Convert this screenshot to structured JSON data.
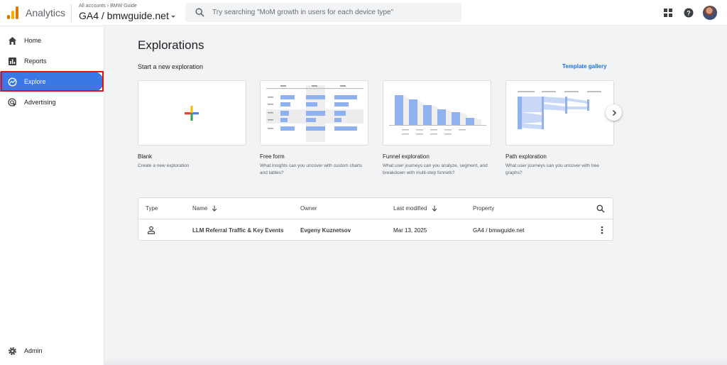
{
  "app": {
    "name": "Analytics",
    "breadcrumb": {
      "all_accounts": "All accounts",
      "account": "BMW Guide"
    },
    "property": "GA4 / bmwguide.net"
  },
  "search": {
    "placeholder": "Try searching \"MoM growth in users for each device type\""
  },
  "header_icons": [
    "apps-grid-icon",
    "help-icon",
    "avatar"
  ],
  "sidebar": {
    "items": [
      {
        "label": "Home",
        "icon": "home-icon"
      },
      {
        "label": "Reports",
        "icon": "reports-icon"
      },
      {
        "label": "Explore",
        "icon": "explore-icon",
        "active": true
      },
      {
        "label": "Advertising",
        "icon": "advertising-icon"
      }
    ],
    "admin": {
      "label": "Admin",
      "icon": "gear-icon"
    }
  },
  "main": {
    "title": "Explorations",
    "start_label": "Start a new exploration",
    "template_gallery": "Template gallery",
    "templates": [
      {
        "title": "Blank",
        "desc": "Create a new exploration"
      },
      {
        "title": "Free form",
        "desc": "What insights can you uncover with custom charts and tables?"
      },
      {
        "title": "Funnel exploration",
        "desc": "What user journeys can you analyze, segment, and breakdown with multi-step funnels?"
      },
      {
        "title": "Path exploration",
        "desc": "What user journeys can you uncover with tree graphs?"
      }
    ]
  },
  "table": {
    "headers": {
      "type": "Type",
      "name": "Name",
      "owner": "Owner",
      "last_modified": "Last modified",
      "property": "Property"
    },
    "rows": [
      {
        "type_icon": "person-icon",
        "name": "LLM Referral Traffic & Key Events",
        "owner": "Evgeny Kuznetsov",
        "last_modified": "Mar 13, 2025",
        "property": "GA4 / bmwguide.net"
      }
    ]
  },
  "colors": {
    "accent": "#3b78e7",
    "link": "#1a73e8",
    "highlight_border": "#e31212",
    "chart_blue": "#8fb1f0"
  }
}
